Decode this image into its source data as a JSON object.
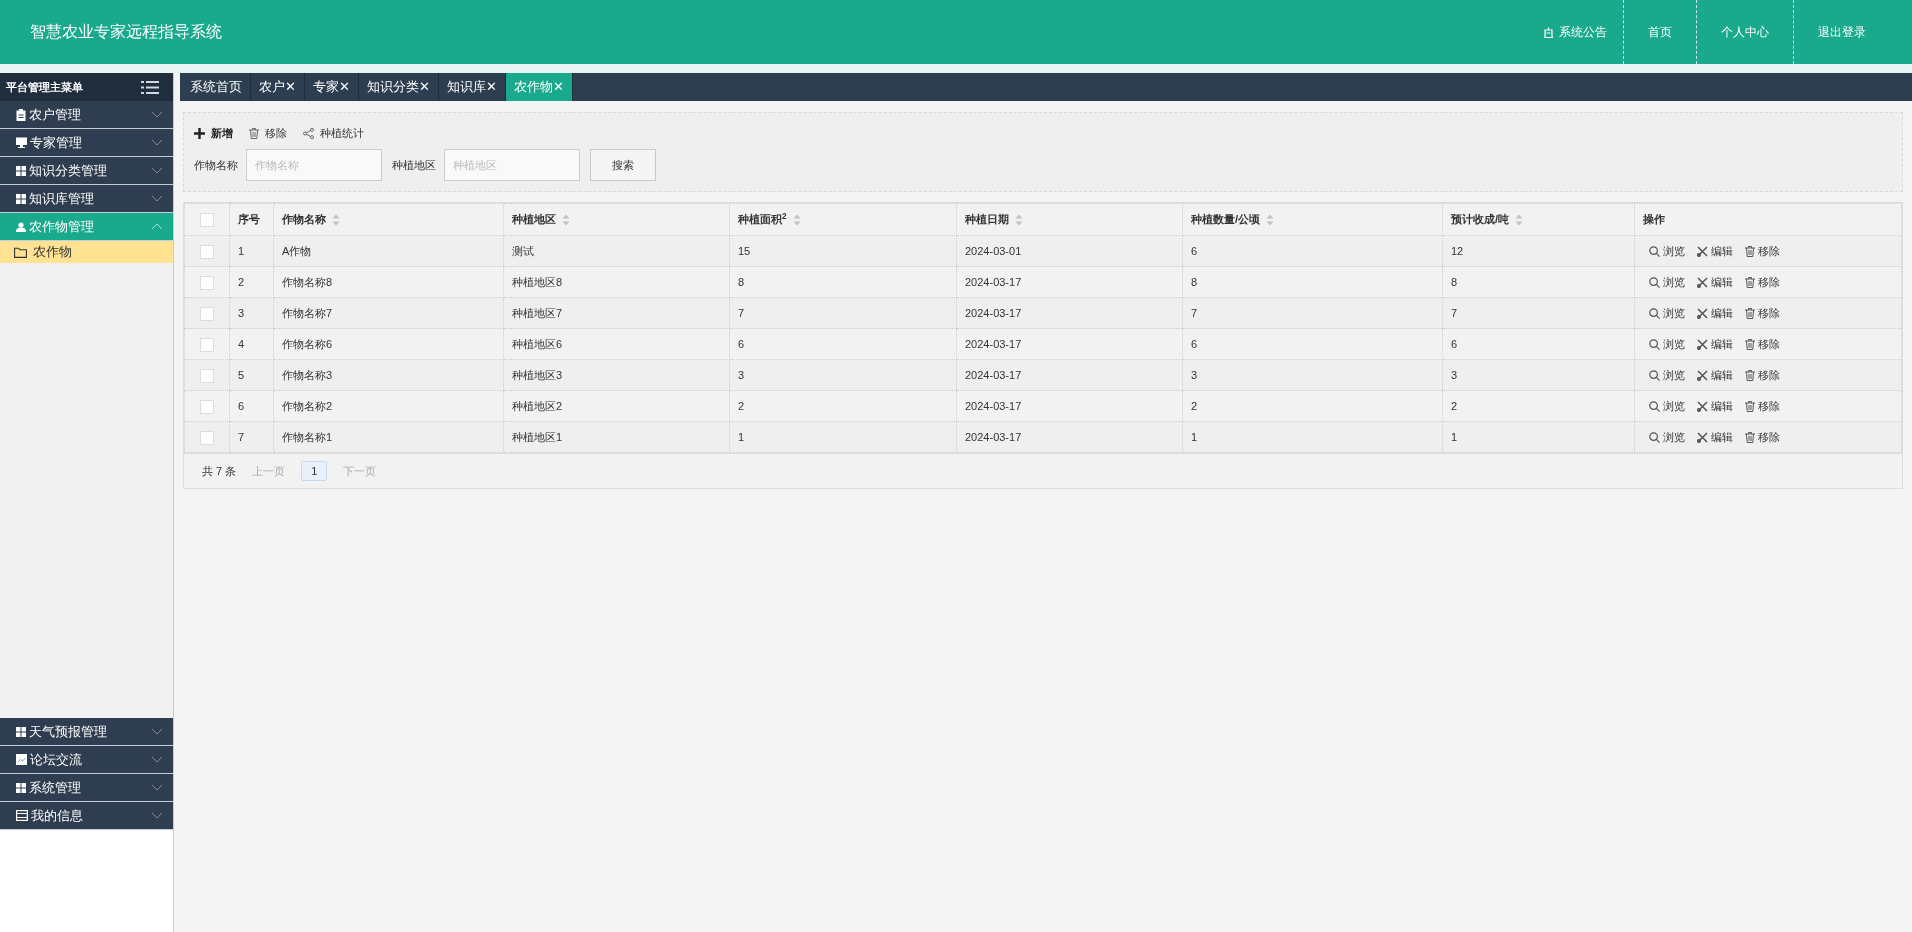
{
  "header": {
    "title": "智慧农业专家远程指导系统",
    "nav": [
      {
        "label": "系统公告"
      },
      {
        "label": "首页"
      },
      {
        "label": "个人中心"
      },
      {
        "label": "退出登录"
      }
    ]
  },
  "sidebar": {
    "title": "平台管理主菜单",
    "top_items": [
      {
        "label": "农户管理",
        "expanded": false
      },
      {
        "label": "专家管理",
        "expanded": false
      },
      {
        "label": "知识分类管理",
        "expanded": false
      },
      {
        "label": "知识库管理",
        "expanded": false
      },
      {
        "label": "农作物管理",
        "expanded": true,
        "children": [
          {
            "label": "农作物",
            "selected": true
          }
        ]
      }
    ],
    "bottom_items": [
      {
        "label": "天气预报管理",
        "expanded": false
      },
      {
        "label": "论坛交流",
        "expanded": false
      },
      {
        "label": "系统管理",
        "expanded": false
      },
      {
        "label": "我的信息",
        "expanded": false
      }
    ]
  },
  "tabs": [
    {
      "label": "系统首页",
      "closable": false,
      "selected": false
    },
    {
      "label": "农户",
      "closable": true,
      "selected": false
    },
    {
      "label": "专家",
      "closable": true,
      "selected": false
    },
    {
      "label": "知识分类",
      "closable": true,
      "selected": false
    },
    {
      "label": "知识库",
      "closable": true,
      "selected": false
    },
    {
      "label": "农作物",
      "closable": true,
      "selected": true
    }
  ],
  "tab_close_glyph": "✕",
  "toolbar": [
    {
      "label": "新增"
    },
    {
      "label": "移除"
    },
    {
      "label": "种植统计"
    }
  ],
  "search": {
    "fields": [
      {
        "label": "作物名称",
        "placeholder": "作物名称"
      },
      {
        "label": "种植地区",
        "placeholder": "种植地区"
      }
    ],
    "button": "搜索"
  },
  "table": {
    "all_checked": false,
    "columns": [
      {
        "label": "序号",
        "sortable": false
      },
      {
        "label": "作物名称",
        "sortable": true
      },
      {
        "label": "种植地区",
        "sortable": true
      },
      {
        "label": "种植面积$^{2}$",
        "sortable": true
      },
      {
        "label": "种植日期",
        "sortable": true
      },
      {
        "label": "种植数量/公顷",
        "sortable": true
      },
      {
        "label": "预计收成/吨",
        "sortable": true
      },
      {
        "label": "操作",
        "sortable": false
      }
    ],
    "rows": [
      {
        "checked": false,
        "cells": [
          "1",
          "A作物",
          "测试",
          "15",
          "2024-03-01",
          "6",
          "12"
        ],
        "actions": [
          "浏览",
          "编辑",
          "移除"
        ]
      },
      {
        "checked": false,
        "cells": [
          "2",
          "作物名称8",
          "种植地区8",
          "8",
          "2024-03-17",
          "8",
          "8"
        ],
        "actions": [
          "浏览",
          "编辑",
          "移除"
        ]
      },
      {
        "checked": false,
        "cells": [
          "3",
          "作物名称7",
          "种植地区7",
          "7",
          "2024-03-17",
          "7",
          "7"
        ],
        "actions": [
          "浏览",
          "编辑",
          "移除"
        ]
      },
      {
        "checked": false,
        "cells": [
          "4",
          "作物名称6",
          "种植地区6",
          "6",
          "2024-03-17",
          "6",
          "6"
        ],
        "actions": [
          "浏览",
          "编辑",
          "移除"
        ]
      },
      {
        "checked": false,
        "cells": [
          "5",
          "作物名称3",
          "种植地区3",
          "3",
          "2024-03-17",
          "3",
          "3"
        ],
        "actions": [
          "浏览",
          "编辑",
          "移除"
        ]
      },
      {
        "checked": false,
        "cells": [
          "6",
          "作物名称2",
          "种植地区2",
          "2",
          "2024-03-17",
          "2",
          "2"
        ],
        "actions": [
          "浏览",
          "编辑",
          "移除"
        ]
      },
      {
        "checked": false,
        "cells": [
          "7",
          "作物名称1",
          "种植地区1",
          "1",
          "2024-03-17",
          "1",
          "1"
        ],
        "actions": [
          "浏览",
          "编辑",
          "移除"
        ]
      }
    ]
  },
  "pagination": {
    "total": "共 7 条",
    "prev": "上一页",
    "pages": [
      {
        "label": "1",
        "selected": true
      }
    ],
    "next": "下一页"
  }
}
